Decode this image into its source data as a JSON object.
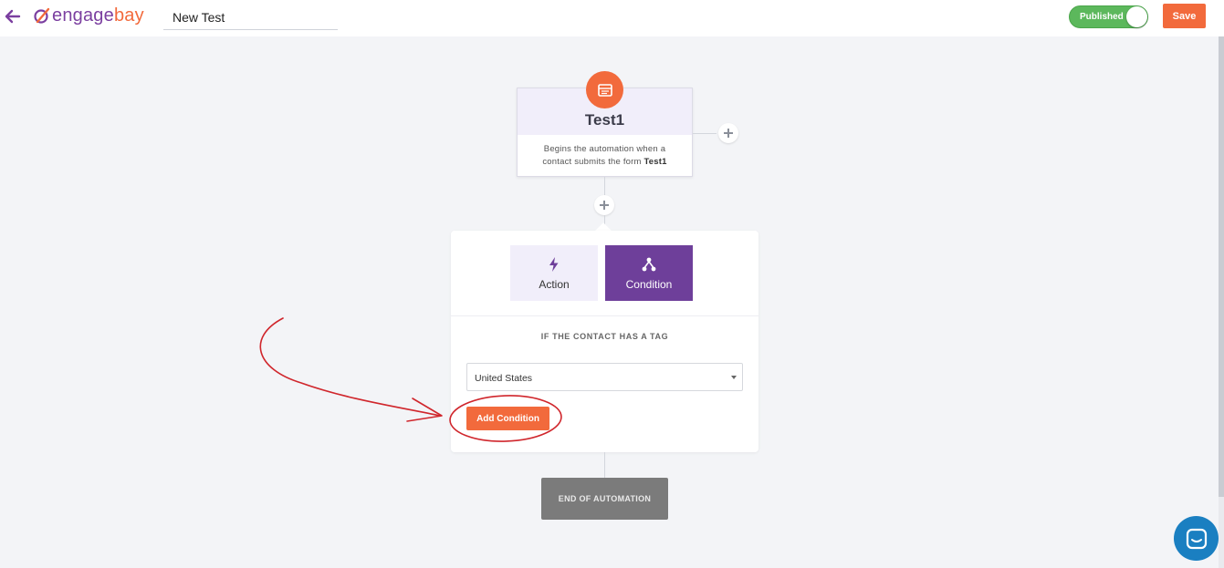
{
  "header": {
    "logo": {
      "part1": "engage",
      "part2": "bay"
    },
    "automation_name": "New Test",
    "status_toggle": {
      "label": "Published",
      "on": true
    },
    "save_label": "Save"
  },
  "trigger": {
    "title": "Test1",
    "description_prefix": "Begins the automation when a contact submits the form",
    "description_form": "Test1",
    "icon": "form-icon"
  },
  "panel": {
    "tabs": [
      {
        "label": "Action",
        "icon": "lightning-icon",
        "selected": false
      },
      {
        "label": "Condition",
        "icon": "branch-icon",
        "selected": true
      }
    ],
    "condition_heading": "IF THE CONTACT HAS A TAG",
    "tag_select": {
      "value": "United States"
    },
    "add_condition_label": "Add Condition"
  },
  "end": {
    "label": "END OF AUTOMATION"
  },
  "colors": {
    "brand_orange": "#f26a3c",
    "brand_purple": "#6e3f9a",
    "toggle_green": "#5cb85c",
    "annotation_red": "#d0262c"
  }
}
